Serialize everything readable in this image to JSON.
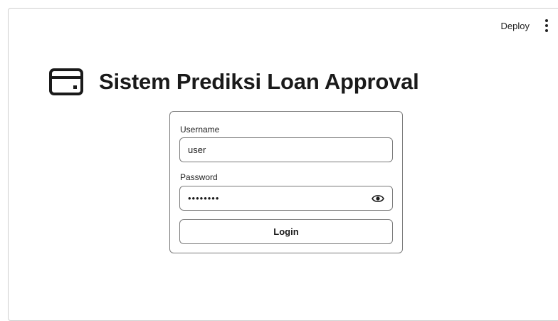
{
  "header": {
    "deploy_label": "Deploy",
    "menu_icon": "more-vertical-icon"
  },
  "page": {
    "title": "Sistem Prediksi Loan Approval",
    "title_icon": "credit-card-icon"
  },
  "login_form": {
    "username_label": "Username",
    "username_value": "user",
    "password_label": "Password",
    "password_masked": "••••••••",
    "password_toggle_icon": "eye-icon",
    "login_button_label": "Login"
  }
}
